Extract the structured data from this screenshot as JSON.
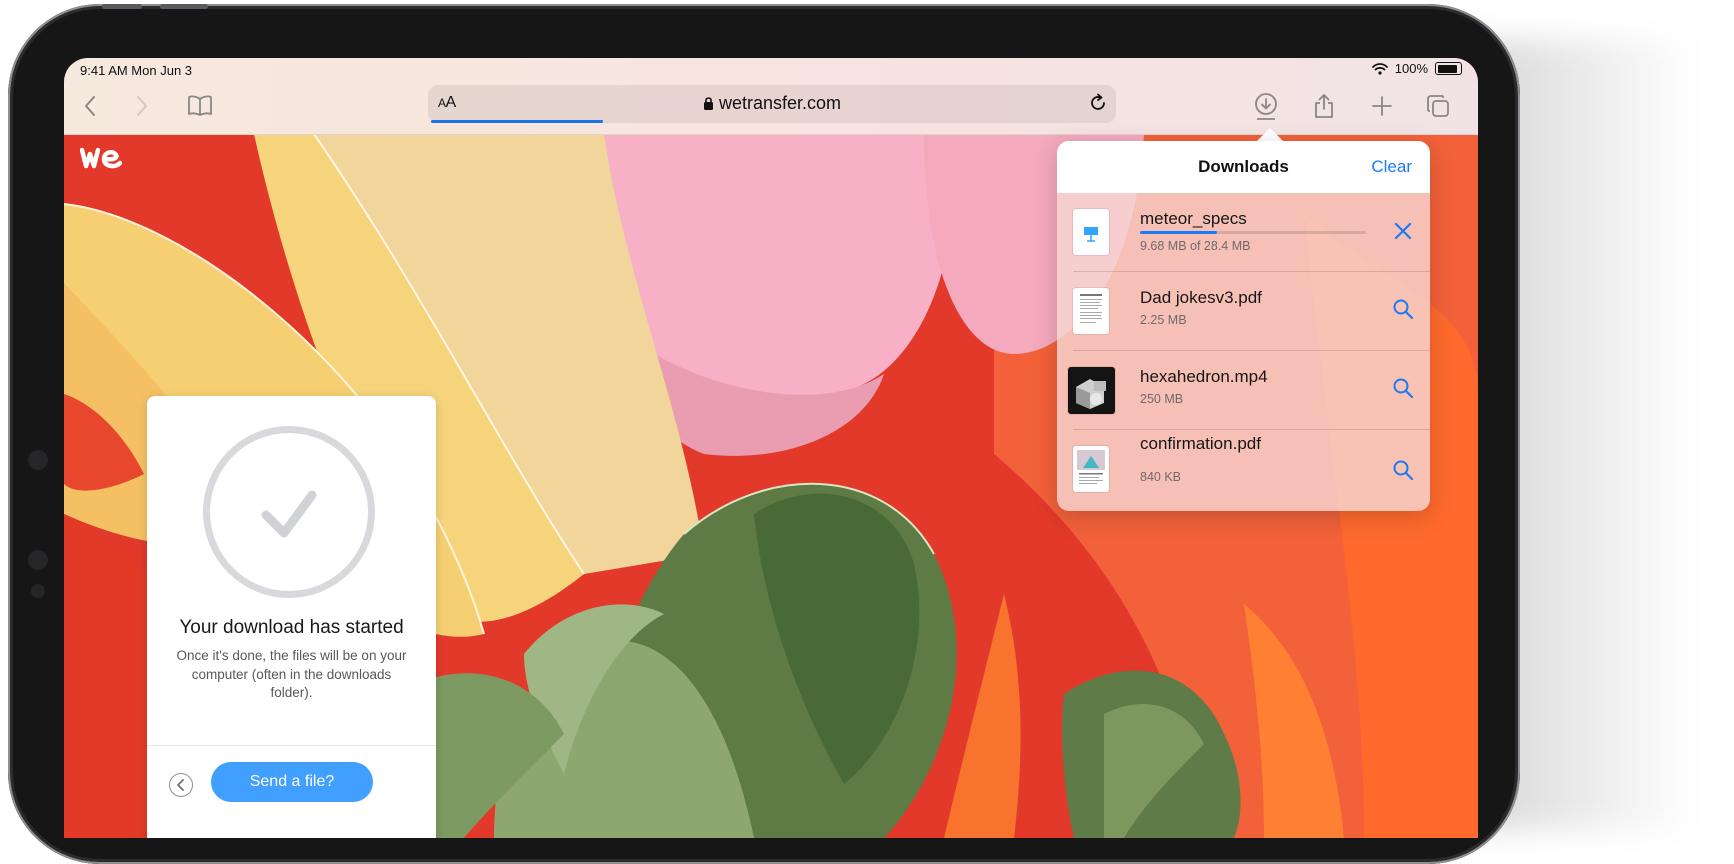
{
  "status_bar": {
    "time": "9:41 AM  Mon Jun 3",
    "battery": "100%"
  },
  "toolbar": {
    "text_size_label": "AA",
    "url": "wetransfer.com",
    "page_load_progress": 0.25,
    "icons": [
      "back-chevron-icon",
      "forward-chevron-icon",
      "bookmarks-icon",
      "reload-icon",
      "download-icon",
      "share-icon",
      "plus-icon",
      "tabs-icon"
    ]
  },
  "card": {
    "title": "Your download has started",
    "text": "Once it's done, the files will be on your computer (often in the downloads folder).",
    "send_button": "Send a file?"
  },
  "downloads": {
    "title": "Downloads",
    "clear_label": "Clear",
    "items": [
      {
        "name": "meteor_specs",
        "size": "9.68 MB of 28.4 MB",
        "progress": 0.34,
        "action": "cancel"
      },
      {
        "name": "Dad jokesv3.pdf",
        "size": "2.25 MB",
        "action": "reveal"
      },
      {
        "name": "hexahedron.mp4",
        "size": "250 MB",
        "action": "reveal"
      },
      {
        "name": "confirmation.pdf",
        "size": "840 KB",
        "action": "reveal"
      }
    ]
  },
  "colors": {
    "accent": "#1a7cf5",
    "send_button": "#409fff",
    "wallpaper_red": "#e8372a"
  }
}
